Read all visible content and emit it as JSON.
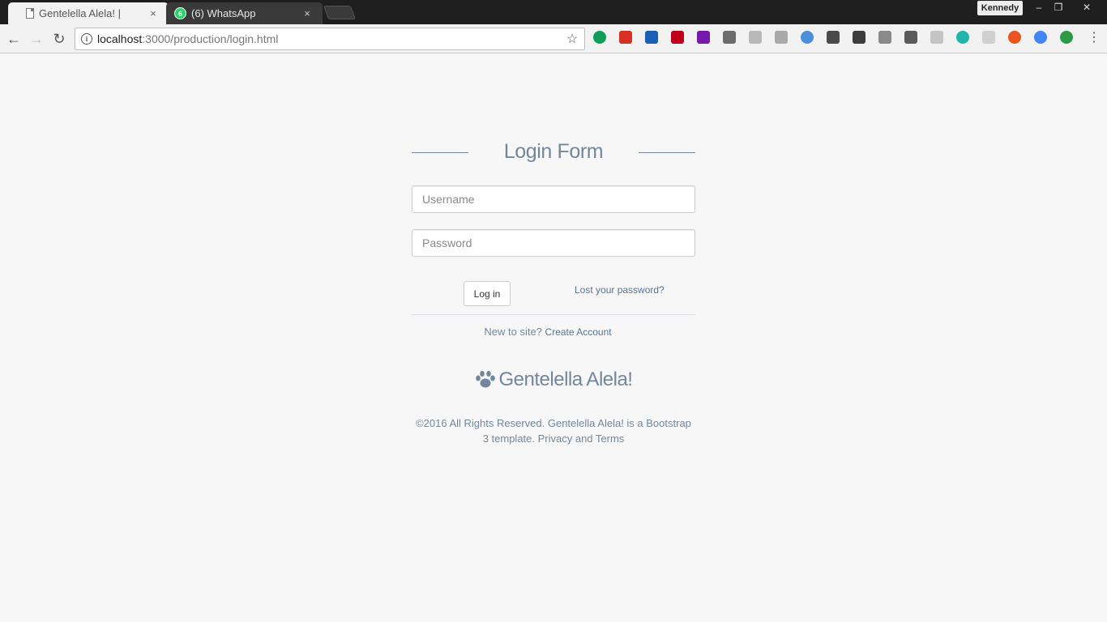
{
  "browser": {
    "tabs": [
      {
        "title": "Gentelella Alela! |",
        "close": "×"
      },
      {
        "title": "(6) WhatsApp",
        "badge": "6",
        "close": "×"
      }
    ],
    "profile_name": "Kennedy",
    "window_controls": {
      "minimize": "–",
      "maximize": "❐",
      "close": "✕"
    },
    "nav": {
      "back": "←",
      "forward": "→",
      "reload": "↻"
    },
    "url_host": "localhost",
    "url_path": ":3000/production/login.html",
    "info_glyph": "i",
    "star_glyph": "☆",
    "menu_glyph": "⋮",
    "extensions": [
      {
        "name": "hangouts-icon",
        "color": "#0f9d58"
      },
      {
        "name": "gmail-icon",
        "color": "#d93025"
      },
      {
        "name": "bird-icon",
        "color": "#1a5fb4"
      },
      {
        "name": "adblock-icon",
        "color": "#c0001a"
      },
      {
        "name": "onenote-icon",
        "color": "#7719aa"
      },
      {
        "name": "monitor-icon",
        "color": "#6c6c6c"
      },
      {
        "name": "ghost-icon",
        "color": "#b9b9b9"
      },
      {
        "name": "angular-icon",
        "color": "#a9a9a9"
      },
      {
        "name": "check-icon",
        "color": "#4a90d9"
      },
      {
        "name": "bus-icon",
        "color": "#4a4a4a"
      },
      {
        "name": "evernote-icon",
        "color": "#3d3d3d"
      },
      {
        "name": "share-icon",
        "color": "#8a8a8a"
      },
      {
        "name": "bulb-icon",
        "color": "#5a5a5a"
      },
      {
        "name": "cloud-icon",
        "color": "#c4c4c4"
      },
      {
        "name": "m-icon",
        "color": "#1fb5ad"
      },
      {
        "name": "pin-icon",
        "color": "#cfcfcf"
      },
      {
        "name": "ubuntu-icon",
        "color": "#e95420"
      },
      {
        "name": "compass-icon",
        "color": "#4285f4"
      },
      {
        "name": "id-icon",
        "color": "#2e9a44"
      }
    ]
  },
  "login": {
    "title": "Login Form",
    "username_placeholder": "Username",
    "password_placeholder": "Password",
    "login_button": "Log in",
    "lost_password": "Lost your password?",
    "new_to_site": "New to site?",
    "create_account": "Create Account",
    "brand": "Gentelella Alela!",
    "copyright": "©2016 All Rights Reserved. Gentelella Alela! is a Bootstrap 3 template. Privacy and Terms"
  },
  "colors": {
    "text_muted": "#73879c",
    "link": "#5a738e",
    "page_bg": "#f7f7f7"
  }
}
